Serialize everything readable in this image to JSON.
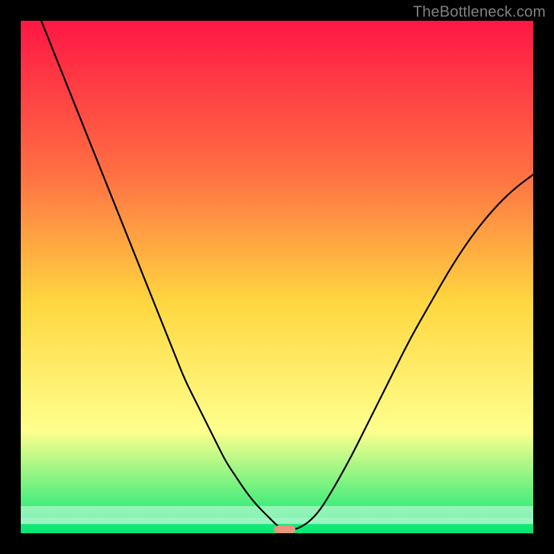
{
  "watermark": "TheBottleneck.com",
  "chart_data": {
    "type": "line",
    "title": "",
    "xlabel": "",
    "ylabel": "",
    "xlim": [
      0,
      100
    ],
    "ylim": [
      0,
      100
    ],
    "grid": false,
    "background_gradient": {
      "top": "#ff1744",
      "upper_mid": "#ff7043",
      "mid": "#ffd740",
      "lower_mid": "#ffff8d",
      "bottom": "#00e676"
    },
    "series": [
      {
        "name": "curve",
        "x": [
          4,
          6,
          8,
          10,
          12,
          14,
          16,
          18,
          20,
          22,
          24,
          26,
          28,
          30,
          32,
          34,
          36,
          38,
          40,
          42,
          44,
          46,
          48,
          50,
          51,
          52,
          53,
          54,
          56,
          58,
          60,
          64,
          68,
          72,
          76,
          80,
          84,
          88,
          92,
          96,
          100
        ],
        "y": [
          100,
          95,
          90,
          85,
          80,
          75,
          70,
          65,
          60,
          55,
          50,
          45,
          40,
          35,
          30,
          26,
          22,
          18,
          14,
          11,
          8,
          5.5,
          3.5,
          1.5,
          0.9,
          0.7,
          0.7,
          0.9,
          2,
          4,
          7,
          14,
          22,
          30,
          38,
          45,
          52,
          58,
          63,
          67,
          70
        ]
      }
    ],
    "marker": {
      "name": "marker-pill",
      "cx": 51.5,
      "cy": 0.7,
      "width": 4.2,
      "height": 1.6,
      "color": "#e9967a"
    },
    "bottom_bands": [
      {
        "y": 5.3,
        "height": 2.3,
        "opacity": 0.45,
        "color": "#ffffff"
      },
      {
        "y": 3.0,
        "height": 1.2,
        "opacity": 0.55,
        "color": "#ffffff"
      }
    ]
  }
}
